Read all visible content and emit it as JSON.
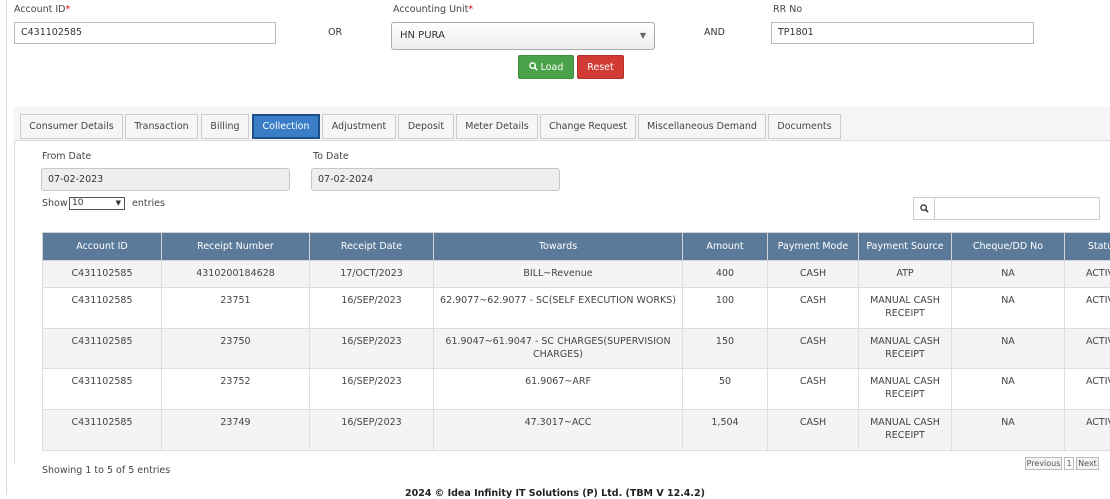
{
  "form": {
    "account_id_label": "Account ID",
    "account_id_value": "C431102585",
    "or_text": "OR",
    "accounting_unit_label": "Accounting Unit",
    "accounting_unit_value": "HN PURA",
    "and_text": "AND",
    "rr_no_label": "RR No",
    "rr_no_value": "TP1801",
    "required_mark": "*",
    "load_label": "Load",
    "reset_label": "Reset"
  },
  "tabs": [
    {
      "label": "Consumer Details"
    },
    {
      "label": "Transaction"
    },
    {
      "label": "Billing"
    },
    {
      "label": "Collection"
    },
    {
      "label": "Adjustment"
    },
    {
      "label": "Deposit"
    },
    {
      "label": "Meter Details"
    },
    {
      "label": "Change Request"
    },
    {
      "label": "Miscellaneous Demand"
    },
    {
      "label": "Documents"
    }
  ],
  "active_tab": "Collection",
  "filters": {
    "from_label": "From Date",
    "from_value": "07-02-2023",
    "to_label": "To Date",
    "to_value": "07-02-2024",
    "show_label": "Show",
    "show_value": "10",
    "entries_label": "entries"
  },
  "table": {
    "headers": [
      "Account ID",
      "Receipt Number",
      "Receipt Date",
      "Towards",
      "Amount",
      "Payment Mode",
      "Payment Source",
      "Cheque/DD No",
      "Status"
    ],
    "rows": [
      [
        "C431102585",
        "4310200184628",
        "17/OCT/2023",
        "BILL~Revenue",
        "400",
        "CASH",
        "ATP",
        "NA",
        "ACTIVE"
      ],
      [
        "C431102585",
        "23751",
        "16/SEP/2023",
        "62.9077~62.9077 - SC(SELF EXECUTION WORKS)",
        "100",
        "CASH",
        "MANUAL CASH RECEIPT",
        "NA",
        "ACTIVE"
      ],
      [
        "C431102585",
        "23750",
        "16/SEP/2023",
        "61.9047~61.9047 - SC CHARGES(SUPERVISION CHARGES)",
        "150",
        "CASH",
        "MANUAL CASH RECEIPT",
        "NA",
        "ACTIVE"
      ],
      [
        "C431102585",
        "23752",
        "16/SEP/2023",
        "61.9067~ARF",
        "50",
        "CASH",
        "MANUAL CASH RECEIPT",
        "NA",
        "ACTIVE"
      ],
      [
        "C431102585",
        "23749",
        "16/SEP/2023",
        "47.3017~ACC",
        "1,504",
        "CASH",
        "MANUAL CASH RECEIPT",
        "NA",
        "ACTIVE"
      ]
    ]
  },
  "pagination": {
    "info": "Showing 1 to 5 of 5 entries",
    "previous": "Previous",
    "page": "1",
    "next": "Next"
  },
  "footer": "2024 © Idea Infinity IT Solutions (P) Ltd. (TBM V 12.4.2)",
  "colors": {
    "tab_active": "#3a7ec8",
    "table_header": "#5b7a99",
    "load_button": "#4aa24a",
    "reset_button": "#d13a35"
  }
}
